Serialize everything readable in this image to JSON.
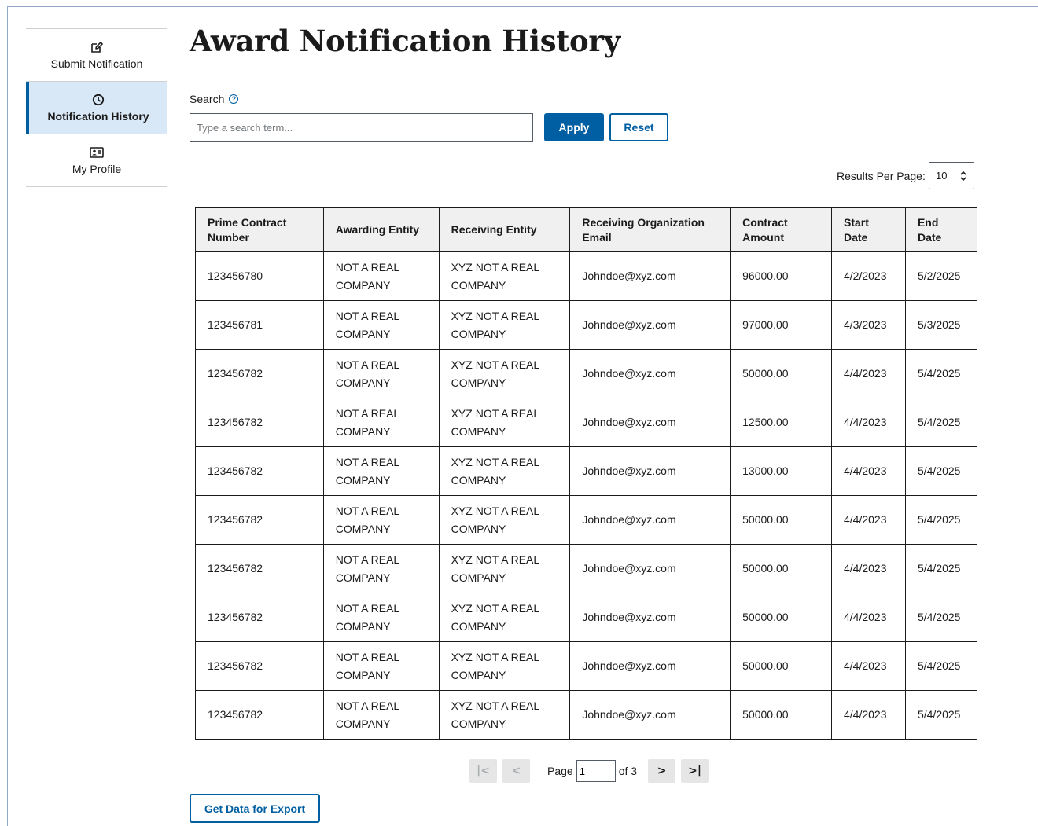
{
  "sidebar": {
    "items": [
      {
        "label": "Submit Notification",
        "icon": "edit-icon"
      },
      {
        "label": "Notification History",
        "icon": "clock-icon"
      },
      {
        "label": "My Profile",
        "icon": "id-card-icon"
      }
    ]
  },
  "page": {
    "title": "Award Notification History"
  },
  "search": {
    "label": "Search",
    "placeholder": "Type a search term...",
    "value": "",
    "apply_label": "Apply",
    "reset_label": "Reset"
  },
  "results_per_page": {
    "label": "Results Per Page:",
    "value": "10"
  },
  "table": {
    "headers": [
      "Prime Contract Number",
      "Awarding Entity",
      "Receiving Entity",
      "Receiving Organization Email",
      "Contract Amount",
      "Start Date",
      "End Date"
    ],
    "rows": [
      [
        "123456780",
        "NOT A REAL COMPANY",
        "XYZ NOT A REAL COMPANY",
        "Johndoe@xyz.com",
        "96000.00",
        "4/2/2023",
        "5/2/2025"
      ],
      [
        "123456781",
        "NOT A REAL COMPANY",
        "XYZ NOT A REAL COMPANY",
        "Johndoe@xyz.com",
        "97000.00",
        "4/3/2023",
        "5/3/2025"
      ],
      [
        "123456782",
        "NOT A REAL COMPANY",
        "XYZ NOT A REAL COMPANY",
        "Johndoe@xyz.com",
        "50000.00",
        "4/4/2023",
        "5/4/2025"
      ],
      [
        "123456782",
        "NOT A REAL COMPANY",
        "XYZ NOT A REAL COMPANY",
        "Johndoe@xyz.com",
        "12500.00",
        "4/4/2023",
        "5/4/2025"
      ],
      [
        "123456782",
        "NOT A REAL COMPANY",
        "XYZ NOT A REAL COMPANY",
        "Johndoe@xyz.com",
        "13000.00",
        "4/4/2023",
        "5/4/2025"
      ],
      [
        "123456782",
        "NOT A REAL COMPANY",
        "XYZ NOT A REAL COMPANY",
        "Johndoe@xyz.com",
        "50000.00",
        "4/4/2023",
        "5/4/2025"
      ],
      [
        "123456782",
        "NOT A REAL COMPANY",
        "XYZ NOT A REAL COMPANY",
        "Johndoe@xyz.com",
        "50000.00",
        "4/4/2023",
        "5/4/2025"
      ],
      [
        "123456782",
        "NOT A REAL COMPANY",
        "XYZ NOT A REAL COMPANY",
        "Johndoe@xyz.com",
        "50000.00",
        "4/4/2023",
        "5/4/2025"
      ],
      [
        "123456782",
        "NOT A REAL COMPANY",
        "XYZ NOT A REAL COMPANY",
        "Johndoe@xyz.com",
        "50000.00",
        "4/4/2023",
        "5/4/2025"
      ],
      [
        "123456782",
        "NOT A REAL COMPANY",
        "XYZ NOT A REAL COMPANY",
        "Johndoe@xyz.com",
        "50000.00",
        "4/4/2023",
        "5/4/2025"
      ]
    ]
  },
  "pagination": {
    "page_label": "Page",
    "current_page": "1",
    "of_label": "of 3",
    "first_icon": "first-page-icon",
    "prev_icon": "previous-page-icon",
    "next_icon": "next-page-icon",
    "last_icon": "last-page-icon"
  },
  "export": {
    "label": "Get Data for Export"
  },
  "colors": {
    "primary": "#005ea2",
    "active_bg": "#d9e8f6",
    "header_bg": "#f0f0f0"
  }
}
